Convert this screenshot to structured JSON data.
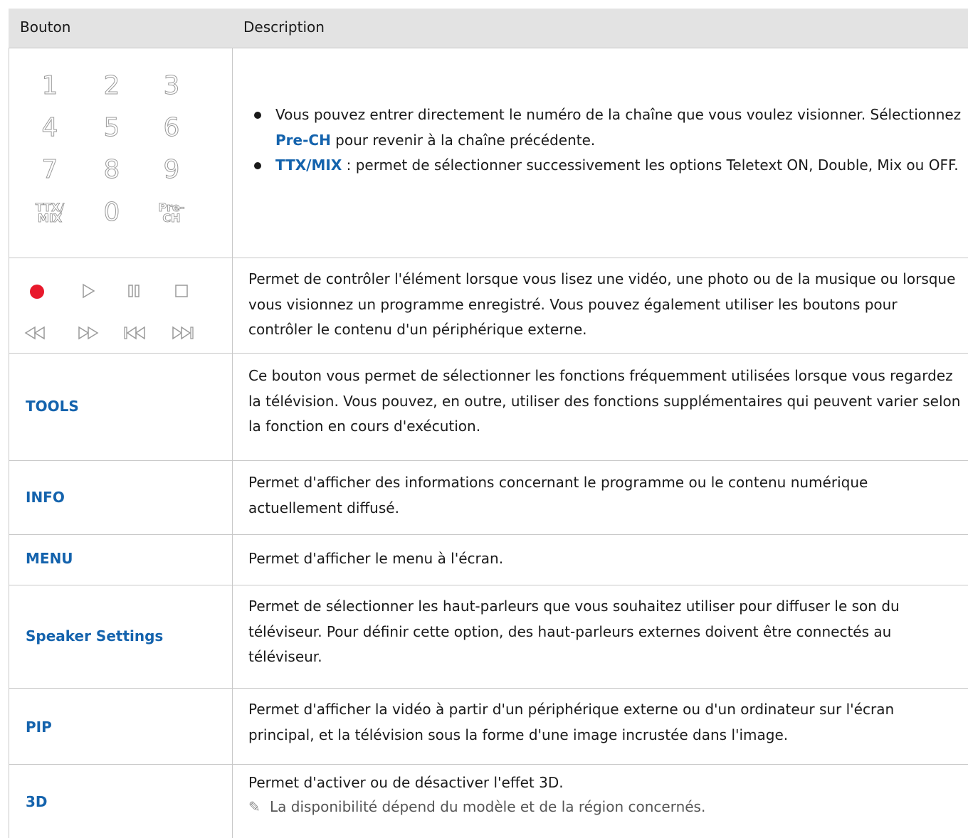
{
  "header": {
    "col_button": "Bouton",
    "col_description": "Description"
  },
  "numpad": {
    "keys": [
      "1",
      "2",
      "3",
      "4",
      "5",
      "6",
      "7",
      "8",
      "9"
    ],
    "ttx_line1": "TTX/",
    "ttx_line2": "MIX",
    "zero": "0",
    "prech_line1": "Pre-",
    "prech_line2": "CH"
  },
  "rows": {
    "numbers": {
      "bullet1_a": "Vous pouvez entrer directement le numéro de la chaîne que vous voulez visionner. Sélectionnez ",
      "bullet1_b": "Pre-CH",
      "bullet1_c": " pour revenir à la chaîne précédente.",
      "bullet2_a": "TTX/MIX",
      "bullet2_b": " : permet de sélectionner successivement les options Teletext ON, Double, Mix ou OFF."
    },
    "playback": {
      "icons": [
        "record-icon",
        "play-icon",
        "pause-icon",
        "stop-icon",
        "rewind-icon",
        "fast-forward-icon",
        "previous-icon",
        "next-icon"
      ],
      "description": "Permet de contrôler l'élément lorsque vous lisez une vidéo, une photo ou de la musique ou lorsque vous visionnez un programme enregistré. Vous pouvez également utiliser les boutons pour contrôler le contenu d'un périphérique externe."
    },
    "tools": {
      "label": "TOOLS",
      "description": "Ce bouton vous permet de sélectionner les fonctions fréquemment utilisées lorsque vous regardez la télévision. Vous pouvez, en outre, utiliser des fonctions supplémentaires qui peuvent varier selon la fonction en cours d'exécution."
    },
    "info": {
      "label": "INFO",
      "description": "Permet d'afficher des informations concernant le programme ou le contenu numérique actuellement diffusé."
    },
    "menu": {
      "label": "MENU",
      "description": "Permet d'afficher le menu à l'écran."
    },
    "speaker": {
      "label": "Speaker Settings",
      "description": "Permet de sélectionner les haut-parleurs que vous souhaitez utiliser pour diffuser le son du téléviseur. Pour définir cette option, des haut-parleurs externes doivent être connectés au téléviseur."
    },
    "pip": {
      "label": "PIP",
      "description": "Permet d'afficher la vidéo à partir d'un périphérique externe ou d'un ordinateur sur l'écran principal, et la télévision sous la forme d'une image incrustée dans l'image."
    },
    "three_d": {
      "label": "3D",
      "description": "Permet d'activer ou de désactiver l'effet 3D.",
      "note": "La disponibilité dépend du modèle et de la région concernés."
    }
  },
  "colors": {
    "accent": "#1463ad",
    "record": "#e8192c",
    "header_bg": "#e3e3e3",
    "border": "#c8c8c8"
  }
}
